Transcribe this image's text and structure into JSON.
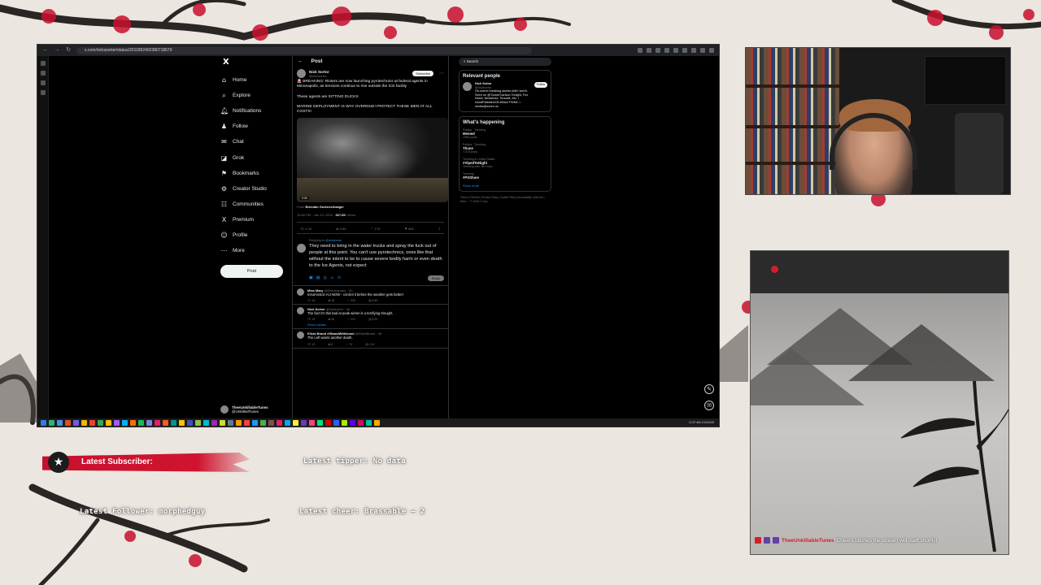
{
  "browser": {
    "url": "x.com/nickssorter/status/2011892492380718579"
  },
  "x_nav": {
    "logo": "X",
    "items": [
      {
        "icon": "home-icon",
        "glyph": "⌂",
        "label": "Home"
      },
      {
        "icon": "search-icon",
        "glyph": "⌕",
        "label": "Explore"
      },
      {
        "icon": "bell-icon",
        "glyph": "🔔︎",
        "label": "Notifications"
      },
      {
        "icon": "follow-icon",
        "glyph": "♟",
        "label": "Follow"
      },
      {
        "icon": "chat-icon",
        "glyph": "✉",
        "label": "Chat"
      },
      {
        "icon": "grok-icon",
        "glyph": "◪",
        "label": "Grok"
      },
      {
        "icon": "bookmark-icon",
        "glyph": "⚑",
        "label": "Bookmarks"
      },
      {
        "icon": "creator-studio-icon",
        "glyph": "⚙",
        "label": "Creator Studio"
      },
      {
        "icon": "communities-icon",
        "glyph": "☷",
        "label": "Communities"
      },
      {
        "icon": "premium-icon",
        "glyph": "X",
        "label": "Premium"
      },
      {
        "icon": "profile-icon",
        "glyph": "☺",
        "label": "Profile"
      },
      {
        "icon": "more-icon",
        "glyph": "⋯",
        "label": "More"
      }
    ],
    "post_button": "Post",
    "account_name": "TheeUnkillableTunes",
    "account_handle": "@UnkilledTunes"
  },
  "post": {
    "header": "Post",
    "author": "Nick Sortor",
    "handle": "@nicksortor",
    "subscribe": "Subscribe",
    "text": "🚨 BREAKING: Rioters are now launching pyrotechnics at federal agents in Minneapolis, as tensions continue to rise outside the ICE facility\n\nThese agents are SITTING DUCKS\n\nMARINE DEPLOYMENT IS WAY OVERDUE! PROTECT THESE MEN AT ALL COSTS!",
    "video_duration": "0:00",
    "from_label": "From",
    "from_user": "Brendan Gutenschwager",
    "timestamp": "10:50 PM · Jan 13, 2026 ·",
    "views": "367.6K",
    "views_label": "Views",
    "counts": {
      "replies": "1.2K",
      "reposts": "4.6K",
      "likes": "17K",
      "bookmarks": "869"
    }
  },
  "reply_box": {
    "replying_to_label": "Replying to",
    "replying_to": "@nicksortor",
    "draft": "They need to bring in the water trucks and spray the fuck out of people at this point. You can't use pyrotechnics, ones like that without the intent to be to cause severe bodily harm or even death to the Ice Agents, not expect",
    "reply_button": "Reply"
  },
  "comments": [
    {
      "name": "Miss Mary",
      "meta": "@Divinelymary · 4h",
      "text": "Insurrection Act NOW - control it before the weather gets better!",
      "counts": [
        "16",
        "18",
        "392",
        "9.6K"
      ],
      "show_replies": ""
    },
    {
      "name": "Nick Sortor",
      "meta": "@nicksortor · 4h",
      "text": "The fact it's this bad at peak winter is a terrifying thought.",
      "counts": [
        "19",
        "28",
        "291",
        "8.2K"
      ],
      "show_replies": "Show replies"
    },
    {
      "name": "Elicia Brand #IStandWithIsrael",
      "meta": "@EliciaBrand · 4h",
      "text": "The Left wants another death.",
      "counts": [
        "12",
        "8",
        "74",
        "2.1K"
      ],
      "show_replies": ""
    }
  ],
  "right": {
    "search_placeholder": "Search",
    "relevant_title": "Relevant people",
    "rp_name": "Nick Sortor",
    "rp_handle": "@nicksortor",
    "rp_follow": "Follow",
    "rp_bio": "On-scene breaking stories killin' worth. Seen on @TuckerCarlson Tonight, Fox News, Newsmax, Timcast, etc. • #JustPalestineOil #Maui FWMC • media@sortor.us",
    "happening_title": "What's happening",
    "trends": [
      {
        "ctx": "Politics · Trending",
        "title": "Memed",
        "posts": "108K posts"
      },
      {
        "ctx": "Politics · Trending",
        "title": "Thune",
        "posts": "7,578 posts"
      },
      {
        "ctx": "Trending in United States",
        "title": "#VlpedToNight",
        "posts": "Trending with Jim Huey"
      },
      {
        "ctx": "Trending",
        "title": "#PSShare",
        "posts": ""
      }
    ],
    "show_more": "Show more",
    "footer": "Terms of Service | Privacy Policy | Cookie Policy | Accessibility | Ads info | More ··· © 2026 X Corp."
  },
  "taskbar": {
    "clock": "11:57 AM 1/14/2026",
    "app_colors": [
      "#2b7de9",
      "#2bb673",
      "#4a90e2",
      "#e44d26",
      "#6c5ce7",
      "#f4b400",
      "#ea4335",
      "#34a853",
      "#fbbc05",
      "#a259ff",
      "#00b2ff",
      "#ff6d00",
      "#1db954",
      "#7289da",
      "#e91e63",
      "#ff5722",
      "#009688",
      "#ffc107",
      "#3f51b5",
      "#8bc34a",
      "#00bcd4",
      "#9c27b0",
      "#cddc39",
      "#607d8b",
      "#ff9800",
      "#f44336",
      "#2196f3",
      "#4caf50",
      "#795548",
      "#e91e63",
      "#03a9f4",
      "#ffeb3b",
      "#673ab7",
      "#ff4081",
      "#00e676",
      "#d50000",
      "#2962ff",
      "#aeea00",
      "#6200ea",
      "#c51162",
      "#00bfa5",
      "#ffab00"
    ]
  },
  "overlay": {
    "latest_subscriber": "Latest Subscriber:",
    "latest_tipper": "Latest tipper: No data",
    "latest_follower": "Latest Follower: morphedguy",
    "latest_cheer": "Latest cheer: Brassable — 2",
    "chat_user": "TheeUnkillableTunes",
    "chat_message": "Cheers bitches the stream will start shortly!"
  },
  "colors": {
    "accent": "#1d9bf0",
    "overlay_red": "#c8102e",
    "background": "#ebe6df"
  }
}
